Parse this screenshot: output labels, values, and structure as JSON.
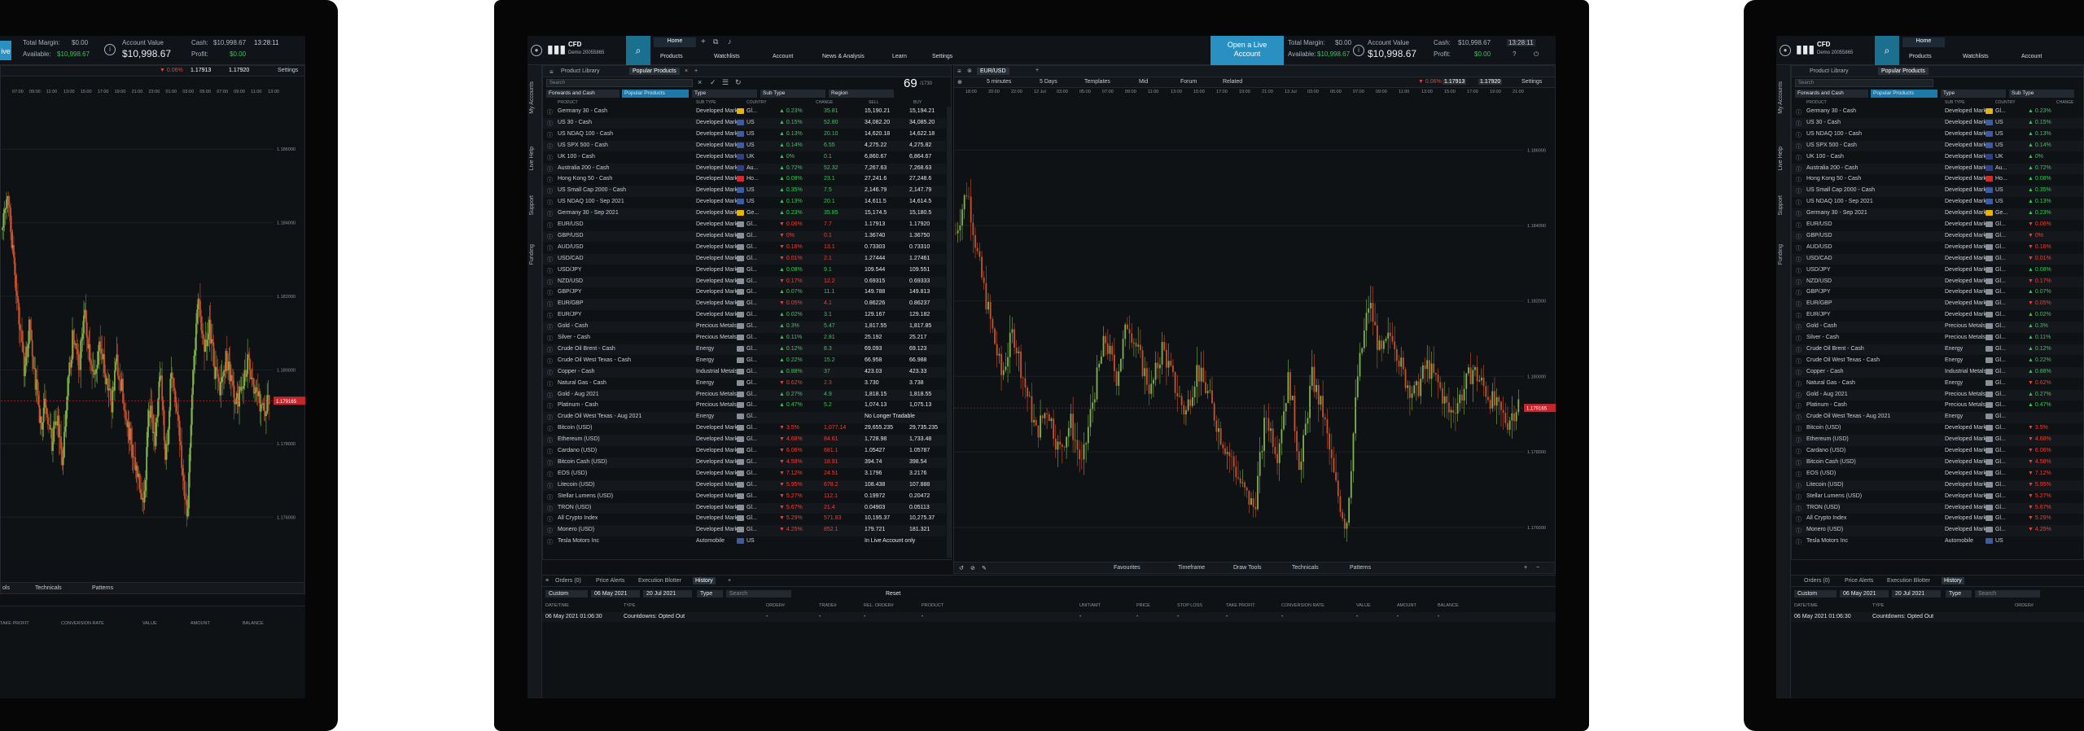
{
  "topbar": {
    "account_name": "CFD",
    "account_id": "Demo 20055865",
    "nav_home": "Home",
    "nav_products": "Products",
    "nav_watchlists": "Watchlists",
    "nav_account": "Account",
    "nav_news": "News & Analysis",
    "nav_learn": "Learn",
    "nav_settings": "Settings",
    "live_btn_line1": "Open a Live",
    "live_btn_line2": "Account",
    "total_margin_label": "Total Margin:",
    "total_margin": "$0.00",
    "available_label": "Available:",
    "available": "$10,998.67",
    "account_value_label": "Account Value",
    "account_value": "$10,998.67",
    "cash_label": "Cash:",
    "cash": "$10,998.67",
    "profit_label": "Profit:",
    "profit": "$0.00",
    "clock": "13:28:11"
  },
  "sidebar": [
    "My Accounts",
    "Live Help",
    "Support",
    "Funding"
  ],
  "product_library": {
    "tabs": [
      "Product Library",
      "Popular Products"
    ],
    "search_placeholder": "Search",
    "count": "69",
    "count_total": "/1730",
    "filters": [
      "Forwards and Cash",
      "Popular Products",
      "Type",
      "Sub Type",
      "Region"
    ],
    "headers": [
      "PRODUCT",
      "SUB TYPE",
      "COUNTRY",
      "CHANGE",
      "SELL",
      "BUY"
    ],
    "rows": [
      {
        "name": "Germany 30 - Cash",
        "sub": "Developed Marke",
        "cty": "Gl...",
        "chg": "▲ 0.23%",
        "d": "35.81",
        "sell": "15,190.21",
        "buy": "15,194.21",
        "up": true,
        "flag": "#e8b400"
      },
      {
        "name": "US 30 - Cash",
        "sub": "Developed Marke",
        "cty": "US",
        "chg": "▲ 0.15%",
        "d": "52.80",
        "sell": "34,082.20",
        "buy": "34,085.20",
        "up": true,
        "flag": "#3b5ba8"
      },
      {
        "name": "US NDAQ 100 - Cash",
        "sub": "Developed Marke",
        "cty": "US",
        "chg": "▲ 0.13%",
        "d": "20.10",
        "sell": "14,620.18",
        "buy": "14,622.18",
        "up": true,
        "flag": "#3b5ba8"
      },
      {
        "name": "US SPX 500 - Cash",
        "sub": "Developed Marke",
        "cty": "US",
        "chg": "▲ 0.14%",
        "d": "6.55",
        "sell": "4,275.22",
        "buy": "4,275.82",
        "up": true,
        "flag": "#3b5ba8"
      },
      {
        "name": "UK 100 - Cash",
        "sub": "Developed Marke",
        "cty": "UK",
        "chg": "▲ 0%",
        "d": "0.1",
        "sell": "6,860.67",
        "buy": "6,864.67",
        "up": true,
        "flag": "#2d3e8f"
      },
      {
        "name": "Australia 200 - Cash",
        "sub": "Developed Marke",
        "cty": "Au...",
        "chg": "▲ 0.72%",
        "d": "52.32",
        "sell": "7,267.63",
        "buy": "7,268.63",
        "up": true,
        "flag": "#2d3e8f"
      },
      {
        "name": "Hong Kong 50 - Cash",
        "sub": "Developed Marke",
        "cty": "Ho...",
        "chg": "▲ 0.08%",
        "d": "23.1",
        "sell": "27,241.6",
        "buy": "27,248.6",
        "up": true,
        "flag": "#d42a2a"
      },
      {
        "name": "US Small Cap 2000 - Cash",
        "sub": "Developed Marke",
        "cty": "US",
        "chg": "▲ 0.35%",
        "d": "7.5",
        "sell": "2,146.79",
        "buy": "2,147.79",
        "up": true,
        "flag": "#3b5ba8"
      },
      {
        "name": "US NDAQ 100 - Sep 2021",
        "sub": "Developed Marke",
        "cty": "US",
        "chg": "▲ 0.13%",
        "d": "20.1",
        "sell": "14,611.5",
        "buy": "14,614.5",
        "up": true,
        "flag": "#3b5ba8"
      },
      {
        "name": "Germany 30 - Sep 2021",
        "sub": "Developed Marke",
        "cty": "Ge...",
        "chg": "▲ 0.23%",
        "d": "35.85",
        "sell": "15,174.5",
        "buy": "15,180.5",
        "up": true,
        "flag": "#e8b400"
      },
      {
        "name": "EUR/USD",
        "sub": "Developed Marke",
        "cty": "Gl...",
        "chg": "▼ 0.06%",
        "d": "7.7",
        "sell": "1.17913",
        "buy": "1.17920",
        "up": false,
        "flag": "#8a9099"
      },
      {
        "name": "GBP/USD",
        "sub": "Developed Marke",
        "cty": "Gl...",
        "chg": "▼ 0%",
        "d": "0.1",
        "sell": "1.36740",
        "buy": "1.36750",
        "up": false,
        "flag": "#8a9099"
      },
      {
        "name": "AUD/USD",
        "sub": "Developed Marke",
        "cty": "Gl...",
        "chg": "▼ 0.16%",
        "d": "13.1",
        "sell": "0.73303",
        "buy": "0.73310",
        "up": false,
        "flag": "#8a9099"
      },
      {
        "name": "USD/CAD",
        "sub": "Developed Marke",
        "cty": "Gl...",
        "chg": "▼ 0.01%",
        "d": "2.1",
        "sell": "1.27444",
        "buy": "1.27461",
        "up": false,
        "flag": "#8a9099"
      },
      {
        "name": "USD/JPY",
        "sub": "Developed Marke",
        "cty": "Gl...",
        "chg": "▲ 0.08%",
        "d": "9.1",
        "sell": "109.544",
        "buy": "109.551",
        "up": true,
        "flag": "#8a9099"
      },
      {
        "name": "NZD/USD",
        "sub": "Developed Marke",
        "cty": "Gl...",
        "chg": "▼ 0.17%",
        "d": "12.2",
        "sell": "0.69315",
        "buy": "0.69333",
        "up": false,
        "flag": "#8a9099"
      },
      {
        "name": "GBP/JPY",
        "sub": "Developed Marke",
        "cty": "Gl...",
        "chg": "▲ 0.07%",
        "d": "11.1",
        "sell": "149.788",
        "buy": "149.813",
        "up": true,
        "flag": "#8a9099"
      },
      {
        "name": "EUR/GBP",
        "sub": "Developed Marke",
        "cty": "Gl...",
        "chg": "▼ 0.05%",
        "d": "4.1",
        "sell": "0.86226",
        "buy": "0.86237",
        "up": false,
        "flag": "#8a9099"
      },
      {
        "name": "EUR/JPY",
        "sub": "Developed Marke",
        "cty": "Gl...",
        "chg": "▲ 0.02%",
        "d": "3.1",
        "sell": "129.167",
        "buy": "129.182",
        "up": true,
        "flag": "#8a9099"
      },
      {
        "name": "Gold - Cash",
        "sub": "Precious Metals",
        "cty": "Gl...",
        "chg": "▲ 0.3%",
        "d": "5.47",
        "sell": "1,817.55",
        "buy": "1,817.85",
        "up": true,
        "flag": "#8a9099"
      },
      {
        "name": "Silver - Cash",
        "sub": "Precious Metals",
        "cty": "Gl...",
        "chg": "▲ 0.11%",
        "d": "2.81",
        "sell": "25.192",
        "buy": "25.217",
        "up": true,
        "flag": "#8a9099"
      },
      {
        "name": "Crude Oil Brent - Cash",
        "sub": "Energy",
        "cty": "Gl...",
        "chg": "▲ 0.12%",
        "d": "8.3",
        "sell": "69.093",
        "buy": "69.123",
        "up": true,
        "flag": "#8a9099"
      },
      {
        "name": "Crude Oil West Texas - Cash",
        "sub": "Energy",
        "cty": "Gl...",
        "chg": "▲ 0.22%",
        "d": "15.2",
        "sell": "66.958",
        "buy": "66.988",
        "up": true,
        "flag": "#8a9099"
      },
      {
        "name": "Copper - Cash",
        "sub": "Industrial Metals",
        "cty": "Gl...",
        "chg": "▲ 0.88%",
        "d": "37",
        "sell": "423.03",
        "buy": "423.33",
        "up": true,
        "flag": "#8a9099"
      },
      {
        "name": "Natural Gas - Cash",
        "sub": "Energy",
        "cty": "Gl...",
        "chg": "▼ 0.62%",
        "d": "2.3",
        "sell": "3.730",
        "buy": "3.738",
        "up": false,
        "flag": "#8a9099"
      },
      {
        "name": "Gold - Aug 2021",
        "sub": "Precious Metals",
        "cty": "Gl...",
        "chg": "▲ 0.27%",
        "d": "4.9",
        "sell": "1,818.15",
        "buy": "1,818.55",
        "up": true,
        "flag": "#8a9099"
      },
      {
        "name": "Platinum - Cash",
        "sub": "Precious Metals",
        "cty": "Gl...",
        "chg": "▲ 0.47%",
        "d": "5.2",
        "sell": "1,074.13",
        "buy": "1,075.13",
        "up": true,
        "flag": "#8a9099"
      },
      {
        "name": "Crude Oil West Texas - Aug 2021",
        "sub": "Energy",
        "cty": "Gl...",
        "chg": "",
        "d": "",
        "sell": "No Longer Tradable",
        "buy": "",
        "up": true,
        "flag": "#8a9099"
      },
      {
        "name": "Bitcoin (USD)",
        "sub": "Developed Marke",
        "cty": "Gl...",
        "chg": "▼ 3.5%",
        "d": "1,077.14",
        "sell": "29,655.235",
        "buy": "29,735.235",
        "up": false,
        "flag": "#8a9099"
      },
      {
        "name": "Ethereum (USD)",
        "sub": "Developed Marke",
        "cty": "Gl...",
        "chg": "▼ 4.68%",
        "d": "84.61",
        "sell": "1,728.98",
        "buy": "1,733.48",
        "up": false,
        "flag": "#8a9099"
      },
      {
        "name": "Cardano (USD)",
        "sub": "Developed Marke",
        "cty": "Gl...",
        "chg": "▼ 6.06%",
        "d": "681.1",
        "sell": "1.05427",
        "buy": "1.05787",
        "up": false,
        "flag": "#8a9099"
      },
      {
        "name": "Bitcoin Cash (USD)",
        "sub": "Developed Marke",
        "cty": "Gl...",
        "chg": "▼ 4.58%",
        "d": "18.91",
        "sell": "394.74",
        "buy": "398.54",
        "up": false,
        "flag": "#8a9099"
      },
      {
        "name": "EOS (USD)",
        "sub": "Developed Marke",
        "cty": "Gl...",
        "chg": "▼ 7.12%",
        "d": "24.51",
        "sell": "3.1796",
        "buy": "3.2176",
        "up": false,
        "flag": "#8a9099"
      },
      {
        "name": "Litecoin (USD)",
        "sub": "Developed Marke",
        "cty": "Gl...",
        "chg": "▼ 5.95%",
        "d": "678.2",
        "sell": "108.438",
        "buy": "107.888",
        "up": false,
        "flag": "#8a9099"
      },
      {
        "name": "Stellar Lumens (USD)",
        "sub": "Developed Marke",
        "cty": "Gl...",
        "chg": "▼ 5.27%",
        "d": "112.1",
        "sell": "0.19972",
        "buy": "0.20472",
        "up": false,
        "flag": "#8a9099"
      },
      {
        "name": "TRON (USD)",
        "sub": "Developed Marke",
        "cty": "Gl...",
        "chg": "▼ 5.67%",
        "d": "21.4",
        "sell": "0.04903",
        "buy": "0.05113",
        "up": false,
        "flag": "#8a9099"
      },
      {
        "name": "All Crypto Index",
        "sub": "Developed Marke",
        "cty": "Gl...",
        "chg": "▼ 5.29%",
        "d": "571.83",
        "sell": "10,195.37",
        "buy": "10,275.37",
        "up": false,
        "flag": "#8a9099"
      },
      {
        "name": "Monero (USD)",
        "sub": "Developed Marke",
        "cty": "Gl...",
        "chg": "▼ 4.25%",
        "d": "852.1",
        "sell": "179.721",
        "buy": "181.321",
        "up": false,
        "flag": "#8a9099"
      },
      {
        "name": "Tesla Motors Inc",
        "sub": "Automobile",
        "cty": "US",
        "chg": "",
        "d": "",
        "sell": "In Live Account only",
        "buy": "",
        "up": true,
        "flag": "#3b5ba8"
      }
    ]
  },
  "chart": {
    "symbol": "EUR/USD",
    "interval": "5 minutes",
    "range": "5 Days",
    "templates": "Templates",
    "mid": "Mid",
    "forum": "Forum",
    "related": "Related",
    "settings": "Settings",
    "sell_price": "1.17913",
    "buy_price": "1.17920",
    "change": "▼ 0.06%",
    "current_price": "1.179165",
    "price_labels": [
      "1.186000",
      "1.184000",
      "1.182000",
      "1.180000",
      "1.178000",
      "1.176000"
    ],
    "time_labels": [
      "18:00",
      "20:00",
      "22:00",
      "12 Jul",
      "03:00",
      "05:00",
      "07:00",
      "09:00",
      "11:00",
      "13:00",
      "15:00",
      "17:00",
      "19:00",
      "21:00",
      "13 Jul",
      "03:00",
      "05:00",
      "07:00",
      "09:00",
      "11:00",
      "13:00",
      "15:00",
      "17:00",
      "19:00",
      "21:00"
    ],
    "bottom": [
      "Favourites",
      "Timeframe",
      "Draw Tools",
      "Technicals",
      "Patterns"
    ],
    "left_bottom": [
      "ols",
      "Technicals",
      "Patterns"
    ],
    "left_time_labels": [
      "07:00",
      "09:00",
      "11:00",
      "13:00",
      "15:00",
      "17:00",
      "19:00",
      "21:00",
      "23:00",
      "01:00",
      "03:00",
      "05:00",
      "07:00",
      "09:00",
      "11:00",
      "13:00"
    ]
  },
  "chart_data": {
    "type": "line",
    "title": "EUR/USD",
    "xlabel": "",
    "ylabel": "",
    "ylim": [
      1.1755,
      1.187
    ],
    "series": [
      {
        "values": [
          1.1838,
          1.185,
          1.183,
          1.1815,
          1.18,
          1.1812,
          1.1798,
          1.1785,
          1.1792,
          1.178,
          1.1788,
          1.1776,
          1.1795,
          1.181,
          1.18,
          1.1815,
          1.1805,
          1.1796,
          1.1808,
          1.1798,
          1.179,
          1.1802,
          1.1795,
          1.1785,
          1.1778,
          1.177,
          1.1765,
          1.179,
          1.178,
          1.18,
          1.1775,
          1.18,
          1.179,
          1.1772,
          1.176,
          1.18,
          1.182,
          1.1805,
          1.1812,
          1.18,
          1.1795,
          1.1803,
          1.1798,
          1.179,
          1.1795,
          1.1802,
          1.1797,
          1.1792,
          1.1788,
          1.1793
        ]
      }
    ]
  },
  "orders": {
    "tabs": [
      "Orders (0)",
      "Price Alerts",
      "Execution Blotter",
      "History"
    ],
    "filter_custom": "Custom",
    "date_from": "06 May 2021",
    "date_to": "20 Jul 2021",
    "type": "Type",
    "search_placeholder": "Search",
    "reset": "Reset",
    "headers": [
      "DATE/TIME",
      "TYPE",
      "ORDER#",
      "TRADE#",
      "REL. ORDER#",
      "PRODUCT",
      "UNIT/AMT",
      "PRICE",
      "STOP LOSS",
      "TAKE PROFIT",
      "CONVERSION RATE",
      "VALUE",
      "AMOUNT",
      "BALANCE"
    ],
    "row": [
      "06 May 2021 01:06:30",
      "Countdowns: Opted Out",
      "-",
      "-",
      "-",
      "-",
      "-",
      "-",
      "-",
      "-",
      "-",
      "-",
      "-",
      "-"
    ]
  },
  "colors": {
    "up": "#3ec25a",
    "down": "#e0443a",
    "accent": "#1c79a8",
    "live": "#2a8fc1"
  }
}
